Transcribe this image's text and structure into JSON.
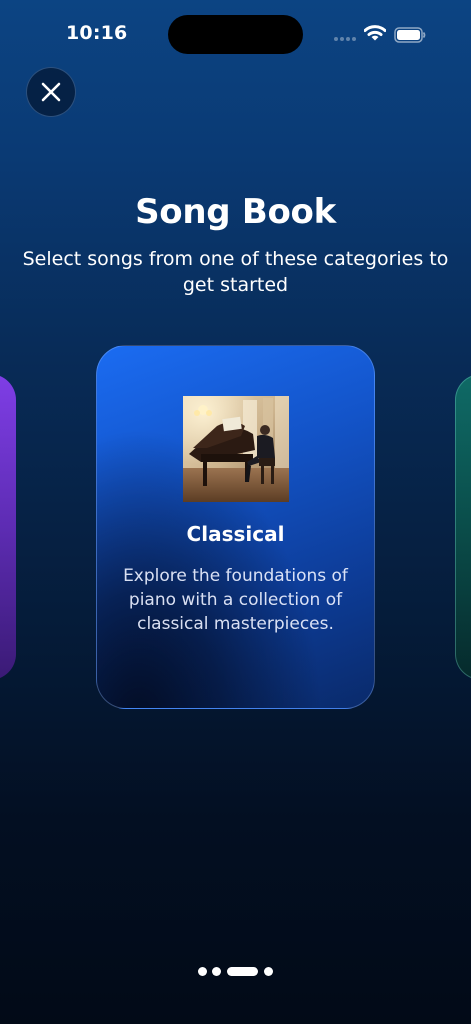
{
  "status_bar": {
    "time": "10:16"
  },
  "header": {
    "title": "Song Book",
    "subtitle": "Select songs from one of these categories to get started"
  },
  "carousel": {
    "active_index": 2,
    "page_count": 4,
    "cards": [
      {
        "color": "#6c34d4"
      },
      {
        "title": "Classical",
        "image": "piano-player-image",
        "description": "Explore the foundations of piano with a collection of classical masterpieces.",
        "color": "#1660e8"
      },
      {
        "color": "#0d5c58"
      }
    ]
  },
  "icons": {
    "close": "close-icon",
    "wifi": "wifi-icon",
    "battery": "battery-icon",
    "signal": "cellular-signal-icon"
  }
}
